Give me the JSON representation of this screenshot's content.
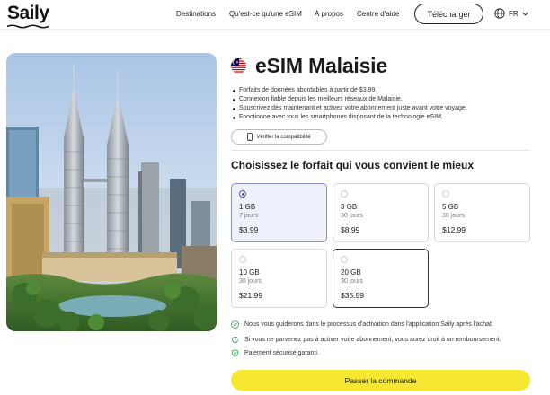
{
  "header": {
    "logo": "Saily",
    "nav": [
      "Destinations",
      "Qu'est-ce qu'une eSIM",
      "À propos",
      "Centre d'aide"
    ],
    "download_label": "Télécharger",
    "lang": "FR"
  },
  "product": {
    "title": "eSIM Malaisie",
    "features": [
      "Forfaits de données abordables à partir de $3.99.",
      "Connexion fiable depuis les meilleurs réseaux de Malaisie.",
      "Souscrivez dès maintenant et activez votre abonnement juste avant votre voyage.",
      "Fonctionne avec tous les smartphones disposant de la technologie eSIM."
    ],
    "compat_label": "Vérifier la compatibilité"
  },
  "plans": {
    "heading": "Choisissez le forfait qui vous convient le mieux",
    "items": [
      {
        "gb": "1 GB",
        "days": "7 jours",
        "price": "$3.99"
      },
      {
        "gb": "3 GB",
        "days": "30 jours",
        "price": "$8.99"
      },
      {
        "gb": "5 GB",
        "days": "30 jours",
        "price": "$12.99"
      },
      {
        "gb": "10 GB",
        "days": "30 jours",
        "price": "$21.99"
      },
      {
        "gb": "20 GB",
        "days": "30 jours",
        "price": "$35.99"
      }
    ],
    "selected": "1 GB"
  },
  "info": [
    "Nous vous guiderons dans le processus d'activation dans l'application Saily après l'achat.",
    "Si vous ne parvenez pas à activer votre abonnement, vous aurez droit à un remboursement.",
    "Paiement sécurisé garanti."
  ],
  "cta_label": "Passer la commande",
  "colors": {
    "accent": "#f6e830",
    "selected_bg": "#eef0fb",
    "selected_radio": "#4b53c8",
    "check_green": "#2fa84f"
  }
}
